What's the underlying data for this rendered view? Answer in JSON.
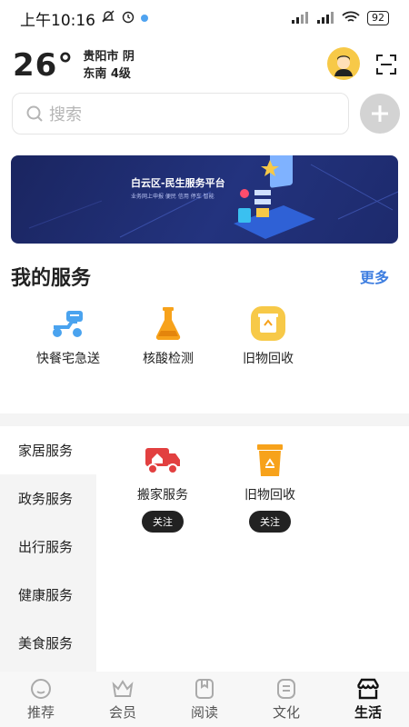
{
  "status_bar": {
    "time": "上午10:16",
    "battery": "92"
  },
  "weather": {
    "temperature": "26°",
    "city_condition": "贵阳市 阴",
    "wind": "东南 4级"
  },
  "search": {
    "placeholder": "搜索"
  },
  "banner": {
    "title": "白云区-民生服务平台",
    "subtitle": "业务网上申报 便民 信用 停车 智能"
  },
  "my_services": {
    "title": "我的服务",
    "more": "更多",
    "items": [
      {
        "label": "快餐宅急送",
        "icon": "scooter-icon"
      },
      {
        "label": "核酸检测",
        "icon": "flask-icon"
      },
      {
        "label": "旧物回收",
        "icon": "recycle-icon"
      }
    ]
  },
  "categories": {
    "items": [
      "家居服务",
      "政务服务",
      "出行服务",
      "健康服务",
      "美食服务"
    ],
    "active": "家居服务"
  },
  "category_services": [
    {
      "label": "搬家服务",
      "follow": "关注",
      "icon": "moving-truck-icon"
    },
    {
      "label": "旧物回收",
      "follow": "关注",
      "icon": "recycle-bin-icon"
    }
  ],
  "bottom_nav": [
    {
      "label": "推荐",
      "icon": "recommend-icon"
    },
    {
      "label": "会员",
      "icon": "crown-icon"
    },
    {
      "label": "阅读",
      "icon": "book-icon"
    },
    {
      "label": "文化",
      "icon": "culture-icon"
    },
    {
      "label": "生活",
      "icon": "life-icon",
      "active": true
    }
  ],
  "colors": {
    "accent": "#3e7ee0",
    "banner": "#1e2a6e",
    "orange": "#f7a21b",
    "red": "#e24040"
  }
}
